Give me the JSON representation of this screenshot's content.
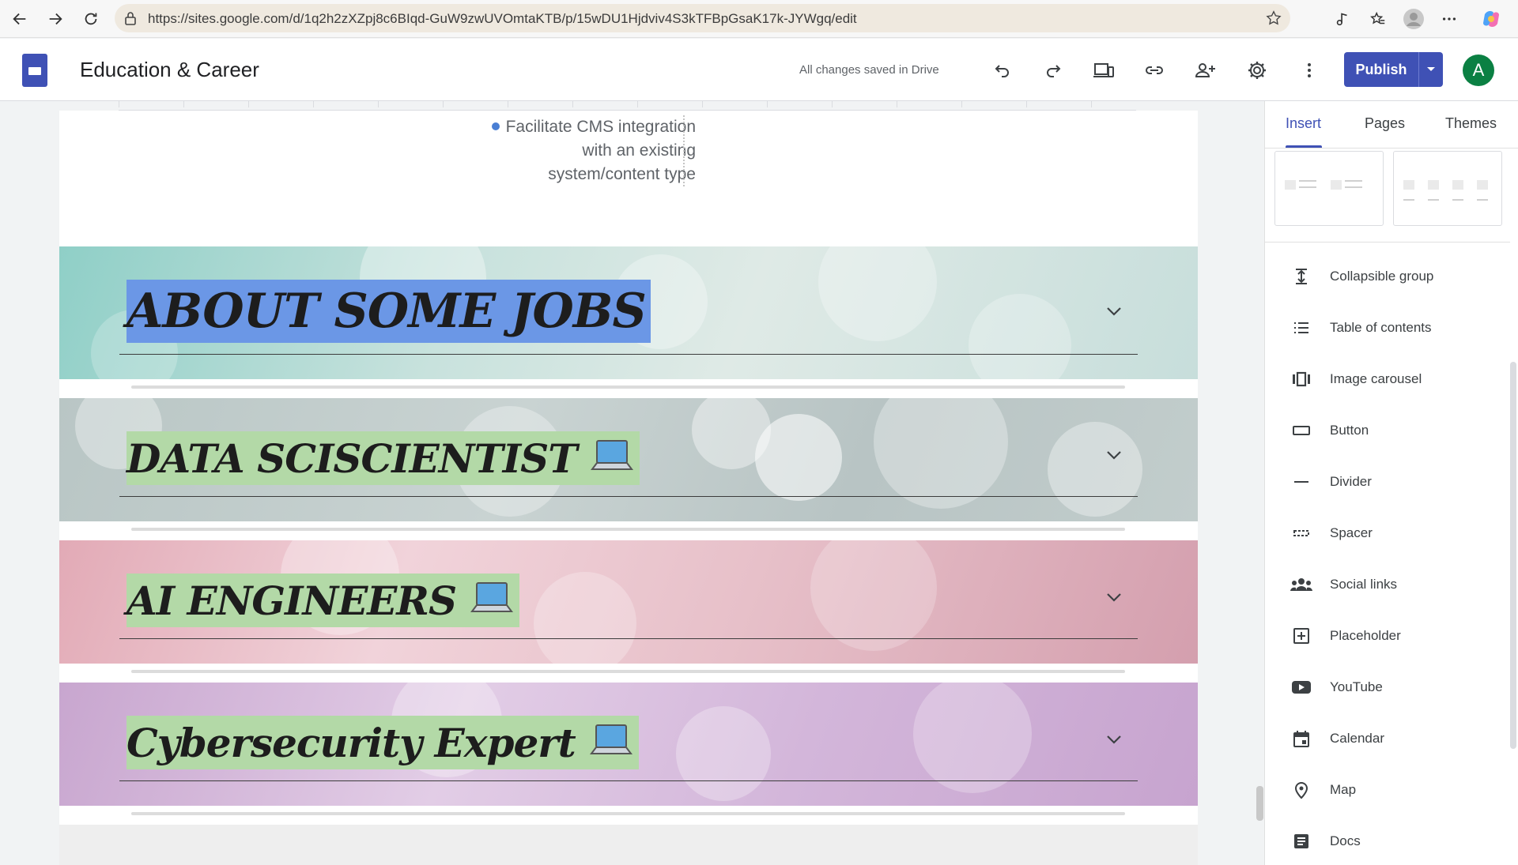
{
  "browser": {
    "url": "https://sites.google.com/d/1q2h2zXZpj8c6BIqd-GuW9zwUVOmtaKTB/p/15wDU1Hjdviv4S3kTFBpGsaK17k-JYWgq/edit"
  },
  "header": {
    "site_title": "Education & Career",
    "save_status": "All changes saved in Drive",
    "publish_label": "Publish",
    "avatar_letter": "A"
  },
  "canvas": {
    "bullet_lines": [
      "Facilitate CMS integration",
      "with an existing",
      "system/content type"
    ],
    "sections": [
      {
        "title": "ABOUT SOME JOBS",
        "highlight_color": "#6b97e6",
        "icon": "none"
      },
      {
        "title": "DATA  SCISCIENTIST",
        "highlight_color": "#b3d9a7",
        "icon": "laptop-icon"
      },
      {
        "title": "AI ENGINEERS",
        "highlight_color": "#b3d9a7",
        "icon": "laptop-icon"
      },
      {
        "title": "Cybersecurity Expert",
        "highlight_color": "#b3d9a7",
        "icon": "laptop-icon"
      }
    ]
  },
  "panel": {
    "tabs": [
      "Insert",
      "Pages",
      "Themes"
    ],
    "active_tab": "Insert",
    "items": [
      {
        "label": "Collapsible group",
        "icon": "collapsible-group-icon"
      },
      {
        "label": "Table of contents",
        "icon": "table-of-contents-icon"
      },
      {
        "label": "Image carousel",
        "icon": "image-carousel-icon"
      },
      {
        "label": "Button",
        "icon": "button-icon"
      },
      {
        "label": "Divider",
        "icon": "divider-icon"
      },
      {
        "label": "Spacer",
        "icon": "spacer-icon"
      },
      {
        "label": "Social links",
        "icon": "social-links-icon"
      },
      {
        "label": "Placeholder",
        "icon": "placeholder-icon"
      },
      {
        "label": "YouTube",
        "icon": "youtube-icon"
      },
      {
        "label": "Calendar",
        "icon": "calendar-icon"
      },
      {
        "label": "Map",
        "icon": "map-icon"
      },
      {
        "label": "Docs",
        "icon": "docs-icon"
      }
    ]
  },
  "colors": {
    "accent": "#3f51b5",
    "avatar_bg": "#0b8043"
  }
}
